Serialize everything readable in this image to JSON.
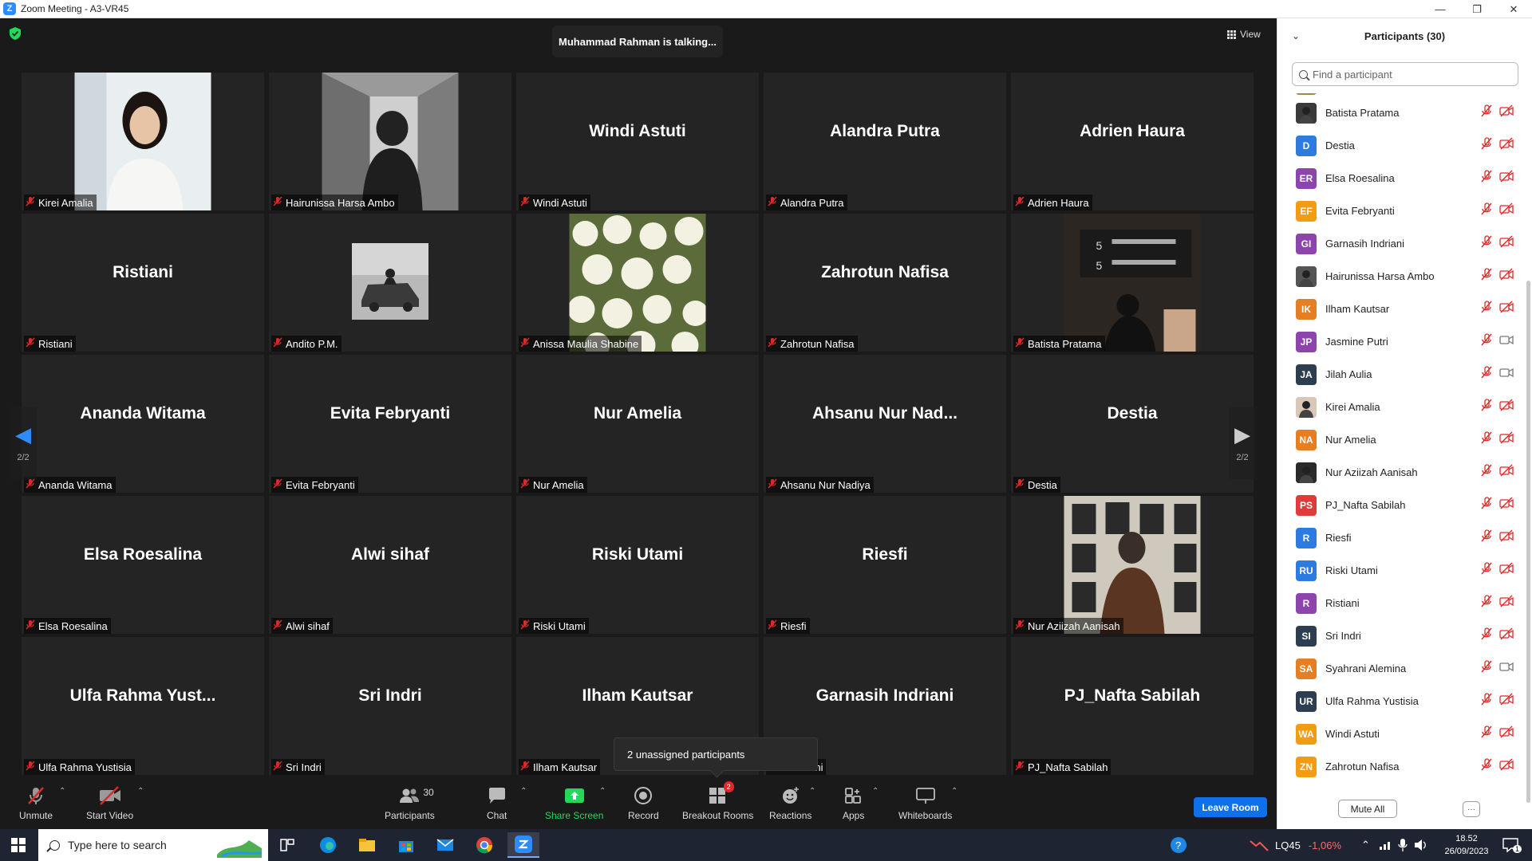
{
  "window": {
    "title": "Zoom Meeting - A3-VR45",
    "controls": [
      "minimize-icon",
      "restore-icon",
      "close-icon"
    ]
  },
  "meeting": {
    "talking_banner": "Muhammad Rahman is talking...",
    "view_label": "View",
    "page_indicator": "2/2",
    "unassigned_popup": "2 unassigned participants",
    "tiles": [
      {
        "display": "photo",
        "label": "Kirei Amalia",
        "photo": "woman-portrait"
      },
      {
        "display": "photo",
        "label": "Hairunissa Harsa Ambo",
        "photo": "mirror-selfie"
      },
      {
        "display": "name",
        "name": "Windi Astuti",
        "label": "Windi Astuti"
      },
      {
        "display": "name",
        "name": "Alandra Putra",
        "label": "Alandra Putra"
      },
      {
        "display": "name",
        "name": "Adrien Haura",
        "label": "Adrien Haura"
      },
      {
        "display": "name",
        "name": "Ristiani",
        "label": "Ristiani"
      },
      {
        "display": "photo-small",
        "label": "Andito P.M.",
        "photo": "car-wreck"
      },
      {
        "display": "photo",
        "label": "Anissa Maulia Shabine",
        "photo": "white-flowers"
      },
      {
        "display": "name",
        "name": "Zahrotun Nafisa",
        "label": "Zahrotun Nafisa"
      },
      {
        "display": "photo",
        "label": "Batista Pratama",
        "photo": "station-sign"
      },
      {
        "display": "name",
        "name": "Ananda Witama",
        "label": "Ananda Witama"
      },
      {
        "display": "name",
        "name": "Evita Febryanti",
        "label": "Evita Febryanti"
      },
      {
        "display": "name",
        "name": "Nur Amelia",
        "label": "Nur Amelia"
      },
      {
        "display": "name",
        "name": "Ahsanu Nur Nad...",
        "label": "Ahsanu Nur Nadiya"
      },
      {
        "display": "name",
        "name": "Destia",
        "label": "Destia"
      },
      {
        "display": "name",
        "name": "Elsa Roesalina",
        "label": "Elsa Roesalina"
      },
      {
        "display": "name",
        "name": "Alwi sihaf",
        "label": "Alwi sihaf"
      },
      {
        "display": "name",
        "name": "Riski Utami",
        "label": "Riski Utami"
      },
      {
        "display": "name",
        "name": "Riesfi",
        "label": "Riesfi"
      },
      {
        "display": "photo",
        "label": "Nur Aziizah Aanisah",
        "photo": "gallery-wall"
      },
      {
        "display": "name",
        "name": "Ulfa Rahma Yust...",
        "label": "Ulfa Rahma Yustisia"
      },
      {
        "display": "name",
        "name": "Sri Indri",
        "label": "Sri Indri"
      },
      {
        "display": "name",
        "name": "Ilham Kautsar",
        "label": "Ilham Kautsar"
      },
      {
        "display": "name",
        "name": "Garnasih Indriani",
        "label": "n Indriani"
      },
      {
        "display": "name",
        "name": "PJ_Nafta Sabilah",
        "label": "PJ_Nafta Sabilah"
      }
    ]
  },
  "toolbar": {
    "unmute": "Unmute",
    "start_video": "Start Video",
    "participants": "Participants",
    "participants_count": "30",
    "chat": "Chat",
    "share_screen": "Share Screen",
    "record": "Record",
    "breakout_rooms": "Breakout Rooms",
    "breakout_badge": "2",
    "reactions": "Reactions",
    "apps": "Apps",
    "whiteboards": "Whiteboards",
    "leave": "Leave Room"
  },
  "panel": {
    "title": "Participants (30)",
    "search_placeholder": "Find a participant",
    "mute_all": "Mute All",
    "more": "···",
    "participants": [
      {
        "name": "Batista Pratama",
        "initials": "",
        "color": "#3a3a3a",
        "photo": true,
        "cam": "off"
      },
      {
        "name": "Destia",
        "initials": "D",
        "color": "#2d7be0",
        "photo": false,
        "cam": "off"
      },
      {
        "name": "Elsa Roesalina",
        "initials": "ER",
        "color": "#8e44ad",
        "photo": false,
        "cam": "off"
      },
      {
        "name": "Evita Febryanti",
        "initials": "EF",
        "color": "#f39c12",
        "photo": false,
        "cam": "off"
      },
      {
        "name": "Garnasih Indriani",
        "initials": "GI",
        "color": "#8e44ad",
        "photo": false,
        "cam": "off"
      },
      {
        "name": "Hairunissa Harsa Ambo",
        "initials": "",
        "color": "#555555",
        "photo": true,
        "cam": "off"
      },
      {
        "name": "Ilham Kautsar",
        "initials": "IK",
        "color": "#e67e22",
        "photo": false,
        "cam": "off"
      },
      {
        "name": "Jasmine Putri",
        "initials": "JP",
        "color": "#8e44ad",
        "photo": false,
        "cam": "on"
      },
      {
        "name": "Jilah Aulia",
        "initials": "JA",
        "color": "#2c3e50",
        "photo": false,
        "cam": "on"
      },
      {
        "name": "Kirei Amalia",
        "initials": "",
        "color": "#d9c7b8",
        "photo": true,
        "cam": "off"
      },
      {
        "name": "Nur Amelia",
        "initials": "NA",
        "color": "#e67e22",
        "photo": false,
        "cam": "off"
      },
      {
        "name": "Nur Aziizah Aanisah",
        "initials": "",
        "color": "#2a2a2a",
        "photo": true,
        "cam": "off"
      },
      {
        "name": "PJ_Nafta Sabilah",
        "initials": "PS",
        "color": "#e03b3b",
        "photo": false,
        "cam": "off"
      },
      {
        "name": "Riesfi",
        "initials": "R",
        "color": "#2d7be0",
        "photo": false,
        "cam": "off"
      },
      {
        "name": "Riski Utami",
        "initials": "RU",
        "color": "#2d7be0",
        "photo": false,
        "cam": "off"
      },
      {
        "name": "Ristiani",
        "initials": "R",
        "color": "#8e44ad",
        "photo": false,
        "cam": "off"
      },
      {
        "name": "Sri Indri",
        "initials": "SI",
        "color": "#2c3e50",
        "photo": false,
        "cam": "off"
      },
      {
        "name": "Syahrani Alemina",
        "initials": "SA",
        "color": "#e67e22",
        "photo": false,
        "cam": "on"
      },
      {
        "name": "Ulfa Rahma Yustisia",
        "initials": "UR",
        "color": "#2c3e50",
        "photo": false,
        "cam": "off"
      },
      {
        "name": "Windi Astuti",
        "initials": "WA",
        "color": "#f39c12",
        "photo": false,
        "cam": "off"
      },
      {
        "name": "Zahrotun Nafisa",
        "initials": "ZN",
        "color": "#f39c12",
        "photo": false,
        "cam": "off"
      }
    ]
  },
  "taskbar": {
    "search_placeholder": "Type here to search",
    "stock_ticker": "LQ45",
    "stock_change": "-1,06%",
    "time": "18.52",
    "date": "26/09/2023",
    "notification_count": "1"
  },
  "colors": {
    "zoom_blue": "#0e71eb",
    "muted_red": "#e02828",
    "share_green": "#23d959",
    "stock_red": "#ff6b6b"
  }
}
